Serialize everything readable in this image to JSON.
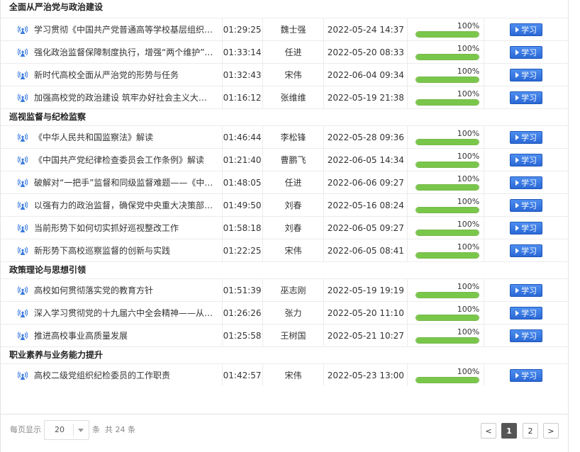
{
  "sections": [
    {
      "title": "全面从严治党与政治建设",
      "courses": [
        {
          "title": "学习贯彻《中国共产党普通高等学校基层组织…",
          "duration": "01:29:25",
          "teacher": "魏士强",
          "date": "2022-05-24 14:37",
          "progress_label": "100%",
          "progress": 1.0,
          "action": "学习"
        },
        {
          "title": "强化政治监督保障制度执行，增强“两个维护”…",
          "duration": "01:33:14",
          "teacher": "任进",
          "date": "2022-05-20 08:33",
          "progress_label": "100%",
          "progress": 1.0,
          "action": "学习"
        },
        {
          "title": "新时代高校全面从严治党的形势与任务",
          "duration": "01:32:43",
          "teacher": "宋伟",
          "date": "2022-06-04 09:34",
          "progress_label": "100%",
          "progress": 1.0,
          "action": "学习"
        },
        {
          "title": "加强高校党的政治建设 筑牢办好社会主义大学…",
          "duration": "01:16:12",
          "teacher": "张维维",
          "date": "2022-05-19 21:38",
          "progress_label": "100%",
          "progress": 1.0,
          "action": "学习"
        }
      ]
    },
    {
      "title": "巡视监督与纪检监察",
      "courses": [
        {
          "title": "《中华人民共和国监察法》解读",
          "duration": "01:46:44",
          "teacher": "李松锋",
          "date": "2022-05-28 09:36",
          "progress_label": "100%",
          "progress": 1.0,
          "action": "学习"
        },
        {
          "title": "《中国共产党纪律检查委员会工作条例》解读",
          "duration": "01:21:40",
          "teacher": "曹鹏飞",
          "date": "2022-06-05 14:34",
          "progress_label": "100%",
          "progress": 1.0,
          "action": "学习"
        },
        {
          "title": "破解对“一把手”监督和同级监督难题——《中…",
          "duration": "01:48:05",
          "teacher": "任进",
          "date": "2022-06-06 09:27",
          "progress_label": "100%",
          "progress": 1.0,
          "action": "学习"
        },
        {
          "title": "以强有力的政治监督，确保党中央重大决策部…",
          "duration": "01:49:50",
          "teacher": "刘春",
          "date": "2022-05-16 08:24",
          "progress_label": "100%",
          "progress": 1.0,
          "action": "学习"
        },
        {
          "title": "当前形势下如何切实抓好巡视整改工作",
          "duration": "01:58:18",
          "teacher": "刘春",
          "date": "2022-06-05 09:27",
          "progress_label": "100%",
          "progress": 1.0,
          "action": "学习"
        },
        {
          "title": "新形势下高校巡察监督的创新与实践",
          "duration": "01:22:25",
          "teacher": "宋伟",
          "date": "2022-06-05 08:41",
          "progress_label": "100%",
          "progress": 1.0,
          "action": "学习"
        }
      ]
    },
    {
      "title": "政策理论与思想引领",
      "courses": [
        {
          "title": "高校如何贯彻落实党的教育方针",
          "duration": "01:51:39",
          "teacher": "巫志刚",
          "date": "2022-05-19 19:19",
          "progress_label": "100%",
          "progress": 1.0,
          "action": "学习"
        },
        {
          "title": "深入学习贯彻党的十九届六中全会精神——从…",
          "duration": "01:26:26",
          "teacher": "张力",
          "date": "2022-05-20 11:10",
          "progress_label": "100%",
          "progress": 1.0,
          "action": "学习"
        },
        {
          "title": "推进高校事业高质量发展",
          "duration": "01:25:58",
          "teacher": "王树国",
          "date": "2022-05-21 10:27",
          "progress_label": "100%",
          "progress": 1.0,
          "action": "学习"
        }
      ]
    },
    {
      "title": "职业素养与业务能力提升",
      "courses": [
        {
          "title": "高校二级党组织纪检委员的工作职责",
          "duration": "01:42:57",
          "teacher": "宋伟",
          "date": "2022-05-23 13:00",
          "progress_label": "100%",
          "progress": 1.0,
          "action": "学习"
        }
      ]
    }
  ],
  "footer": {
    "per_page_label": "每页显示",
    "per_page_value": "20",
    "unit_label": "条",
    "total_label": "共 24 条",
    "prev_label": "<",
    "pages": [
      "1",
      "2"
    ],
    "current_page": "1",
    "next_label": ">"
  },
  "colors": {
    "button": "#2a68d6",
    "progress_fill": "#79c74a",
    "icon": "#3a7be0"
  },
  "icons": {
    "course": "broadcast-icon",
    "button": "play-icon"
  }
}
